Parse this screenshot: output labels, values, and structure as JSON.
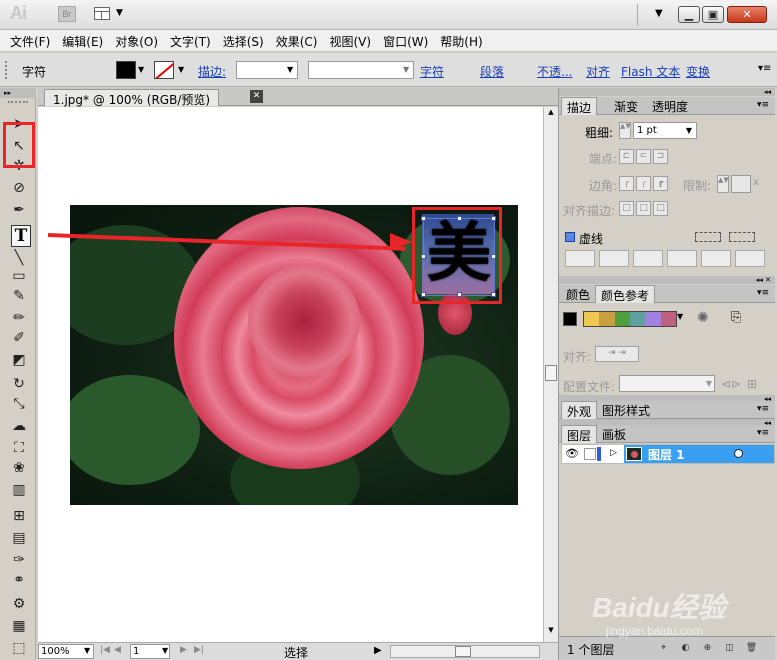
{
  "app": {
    "logo": "Ai",
    "bridge": "Br"
  },
  "menu": [
    "文件(F)",
    "编辑(E)",
    "对象(O)",
    "文字(T)",
    "选择(S)",
    "效果(C)",
    "视图(V)",
    "窗口(W)",
    "帮助(H)"
  ],
  "control": {
    "label": "字符",
    "stroke_link": "描边:",
    "char_link": "字符",
    "para_link": "段落",
    "opacity_link": "不透...",
    "align_link": "对齐",
    "flash_link": "Flash 文本",
    "transform_link": "变换"
  },
  "document": {
    "tab_title": "1.jpg* @ 100% (RGB/预览)",
    "text_glyph": "美"
  },
  "status": {
    "zoom": "100%",
    "page": "1",
    "tool": "选择"
  },
  "stroke_panel": {
    "tabs": [
      "描边",
      "渐变",
      "透明度"
    ],
    "weight_label": "粗细:",
    "weight_value": "1 pt",
    "cap_label": "端点:",
    "corner_label": "边角:",
    "limit_label": "限制:",
    "limit_x": "x",
    "align_label": "对齐描边:",
    "dashed_label": "虚线"
  },
  "color_panel": {
    "tabs": [
      "颜色",
      "颜色参考"
    ],
    "align_label": "对齐:",
    "config_label": "配置文件:"
  },
  "appearance_panel": {
    "tabs": [
      "外观",
      "图形样式"
    ]
  },
  "layers_panel": {
    "tabs": [
      "图层",
      "画板"
    ],
    "layer_name": "图层 1",
    "count": "1 个图层"
  },
  "watermark": {
    "main": "Baidu经验",
    "sub": "jingyan.baidu.com"
  },
  "colors": {
    "annotation_red": "#e8262a",
    "selection_blue": "#3a9ff0",
    "link_blue": "#1a3fb4",
    "swatches": [
      "#f0c850",
      "#c8a040",
      "#50a040",
      "#60a0a0",
      "#a080e0",
      "#c06080"
    ]
  },
  "icons": {
    "tools": [
      "selection-icon",
      "direct-selection-icon",
      "magic-wand-icon",
      "lasso-icon",
      "pen-icon",
      "type-icon",
      "line-icon",
      "rectangle-icon",
      "paintbrush-icon",
      "pencil-icon",
      "blob-brush-icon",
      "eraser-icon",
      "rotate-icon",
      "scale-icon",
      "warp-icon",
      "free-transform-icon",
      "symbol-sprayer-icon",
      "graph-icon",
      "mesh-icon",
      "gradient-icon",
      "eyedropper-icon",
      "blend-icon",
      "live-paint-icon",
      "column-graph-icon",
      "artboard-icon"
    ]
  }
}
